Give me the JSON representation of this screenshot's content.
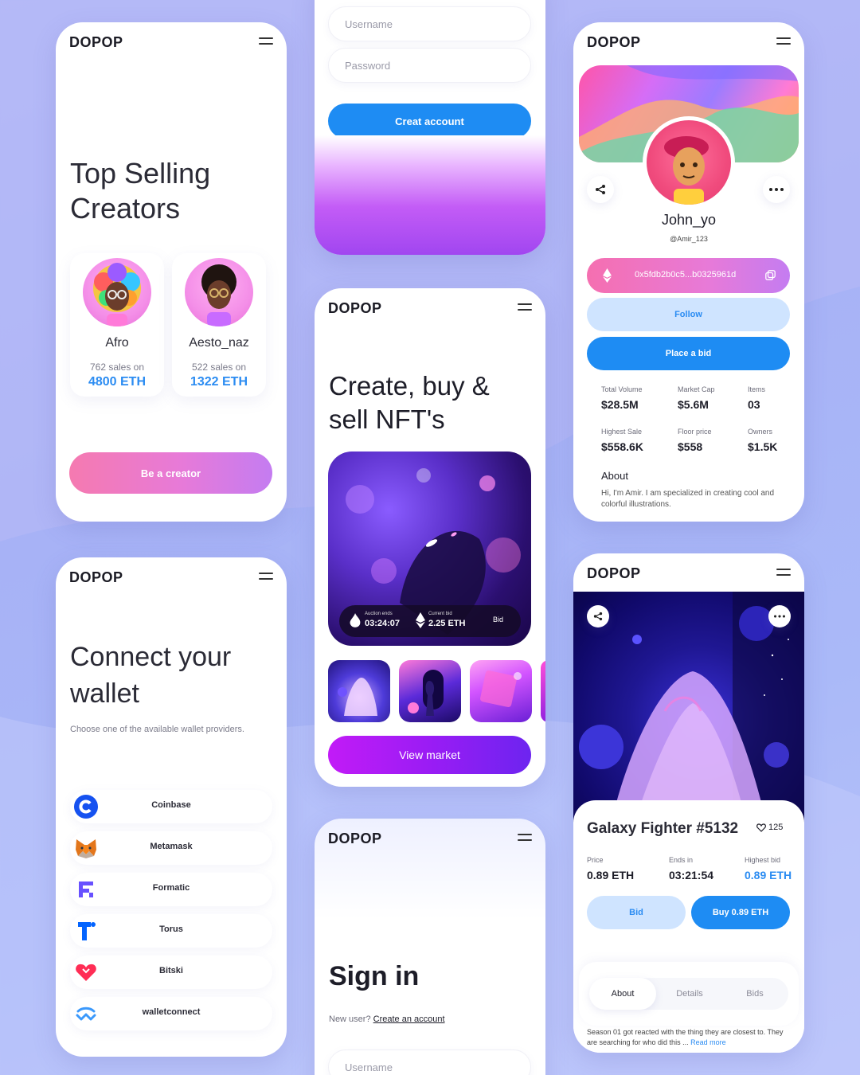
{
  "brand": {
    "logo": "DOPOP"
  },
  "creators": {
    "title": "Top Selling Creators",
    "items": [
      {
        "name": "Afro",
        "sales": "762 sales on",
        "eth": "4800 ETH"
      },
      {
        "name": "Aesto_naz",
        "sales": "522 sales on",
        "eth": "1322 ETH"
      }
    ],
    "cta": "Be a creator"
  },
  "create_account": {
    "username_placeholder": "Username",
    "password_placeholder": "Password",
    "cta": "Creat account"
  },
  "nft": {
    "title": "Create, buy & sell NFT's",
    "auction_label": "Auction ends",
    "auction_value": "03:24:07",
    "bid_label": "Current bid",
    "bid_value": "2.25 ETH",
    "bid_button": "Bid",
    "cta": "View market"
  },
  "signin": {
    "title": "Sign in",
    "new_user": "New user?",
    "create_link": "Create an account",
    "username_placeholder": "Username"
  },
  "wallet": {
    "title": "Connect your wallet",
    "subtitle": "Choose one of the available wallet providers.",
    "providers": [
      {
        "name": "Coinbase",
        "icon": "coinbase-icon"
      },
      {
        "name": "Metamask",
        "icon": "metamask-icon"
      },
      {
        "name": "Formatic",
        "icon": "formatic-icon"
      },
      {
        "name": "Torus",
        "icon": "torus-icon"
      },
      {
        "name": "Bitski",
        "icon": "bitski-icon"
      },
      {
        "name": "walletconnect",
        "icon": "walletconnect-icon"
      }
    ]
  },
  "profile": {
    "name": "John_yo",
    "handle": "@Amir_123",
    "address": "0x5fdb2b0c5...b0325961d",
    "follow": "Follow",
    "place_bid": "Place a bid",
    "stats": [
      {
        "label": "Total Volume",
        "value": "$28.5M"
      },
      {
        "label": "Market Cap",
        "value": "$5.6M"
      },
      {
        "label": "Items",
        "value": "03"
      },
      {
        "label": "Highest Sale",
        "value": "$558.6K"
      },
      {
        "label": "Floor price",
        "value": "$558"
      },
      {
        "label": "Owners",
        "value": "$1.5K"
      }
    ],
    "about_title": "About",
    "about_text": "Hi, I'm Amir. I am specialized in creating cool and colorful illustrations."
  },
  "galaxy": {
    "title": "Galaxy Fighter #5132",
    "likes": "125",
    "price_label": "Price",
    "price_value": "0.89 ETH",
    "ends_label": "Ends in",
    "ends_value": "03:21:54",
    "highest_label": "Highest bid",
    "highest_value": "0.89 ETH",
    "bid_button": "Bid",
    "buy_button": "Buy 0.89 ETH",
    "tabs": [
      "About",
      "Details",
      "Bids"
    ],
    "description": "Season 01 got reacted with the thing they are closest to. They are searching for who did this ...",
    "read_more": "Read more"
  },
  "colors": {
    "accent_blue": "#1e8cf3",
    "accent_purple": "#9a1cf4",
    "accent_pink": "#f57ab0",
    "background": "#aab4f7"
  }
}
